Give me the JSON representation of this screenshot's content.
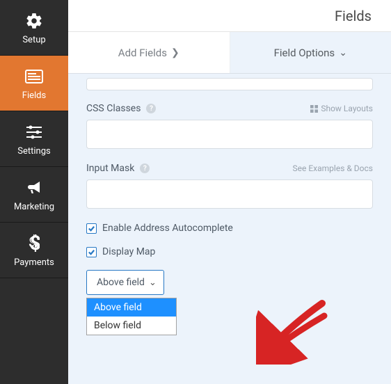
{
  "sidebar": {
    "items": [
      {
        "label": "Setup"
      },
      {
        "label": "Fields"
      },
      {
        "label": "Settings"
      },
      {
        "label": "Marketing"
      },
      {
        "label": "Payments"
      }
    ]
  },
  "topbar": {
    "title": "Fields"
  },
  "tabs": {
    "add": "Add Fields",
    "options": "Field Options"
  },
  "panel": {
    "css_classes": {
      "label": "CSS Classes",
      "hint": "Show Layouts",
      "value": ""
    },
    "input_mask": {
      "label": "Input Mask",
      "hint": "See Examples & Docs",
      "value": ""
    },
    "autocomplete": {
      "label": "Enable Address Autocomplete",
      "checked": true
    },
    "display_map": {
      "label": "Display Map",
      "checked": true
    },
    "map_position": {
      "selected": "Above field",
      "options": [
        "Above field",
        "Below field"
      ]
    }
  }
}
